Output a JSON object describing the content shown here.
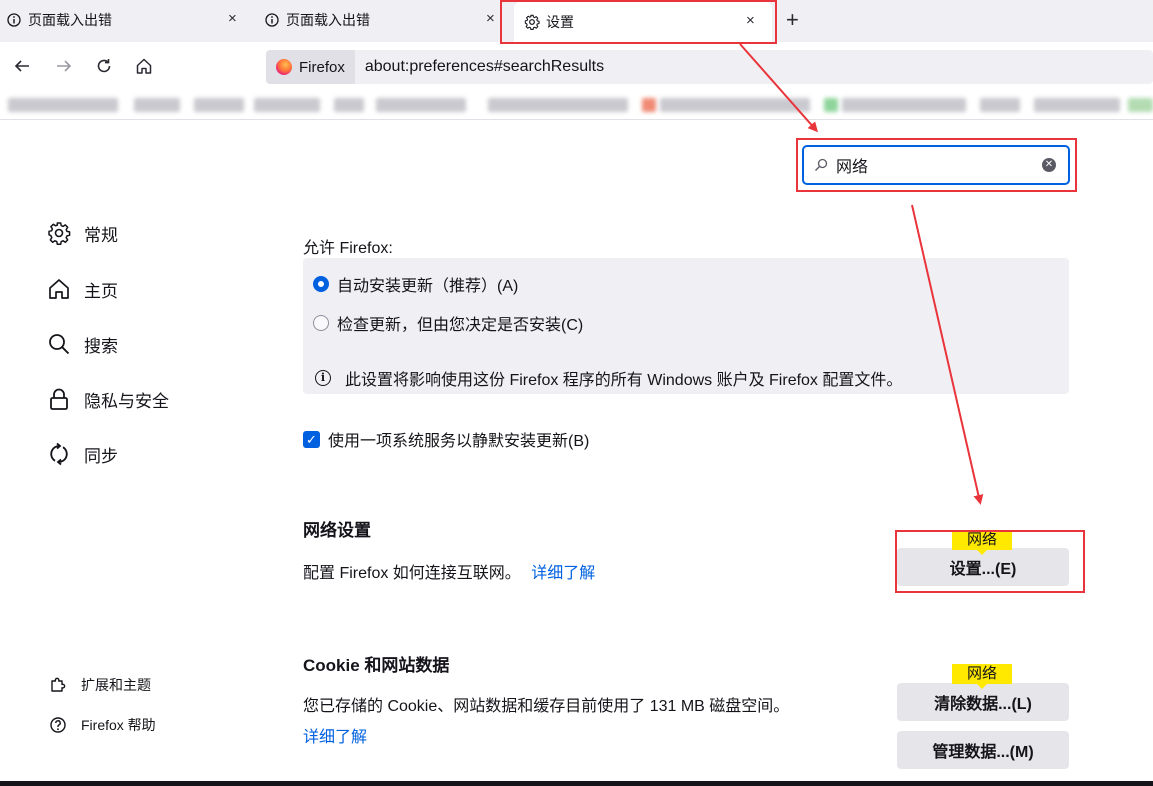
{
  "tabs": [
    {
      "title": "页面载入出错",
      "icon": "info-icon",
      "active": false
    },
    {
      "title": "页面载入出错",
      "icon": "info-icon",
      "active": false
    },
    {
      "title": "设置",
      "icon": "gear-icon",
      "active": true
    }
  ],
  "tab_close_glyph": "×",
  "new_tab_glyph": "+",
  "urlbar": {
    "identity_label": "Firefox",
    "url": "about:preferences#searchResults"
  },
  "search": {
    "value": "网络"
  },
  "sidebar": {
    "items": [
      {
        "label": "常规",
        "icon": "gear-icon"
      },
      {
        "label": "主页",
        "icon": "home-icon"
      },
      {
        "label": "搜索",
        "icon": "search-icon"
      },
      {
        "label": "隐私与安全",
        "icon": "lock-icon"
      },
      {
        "label": "同步",
        "icon": "sync-icon"
      }
    ],
    "footer": [
      {
        "label": "扩展和主题",
        "icon": "puzzle-icon"
      },
      {
        "label": "Firefox 帮助",
        "icon": "help-icon"
      }
    ]
  },
  "updates": {
    "allow_label": "允许 Firefox:",
    "auto_install": "自动安装更新（推荐）(A)",
    "check_only": "检查更新，但由您决定是否安装(C)",
    "info": "此设置将影响使用这份 Firefox 程序的所有 Windows 账户及 Firefox 配置文件。",
    "background_service": "使用一项系统服务以静默安装更新(B)"
  },
  "network": {
    "heading": "网络设置",
    "description": "配置 Firefox 如何连接互联网。",
    "learn_more": "详细了解",
    "settings_button": "设置...(E)",
    "highlight": "网络"
  },
  "cookies": {
    "heading": "Cookie 和网站数据",
    "description": "您已存储的 Cookie、网站数据和缓存目前使用了 131 MB 磁盘空间。",
    "learn_more": "详细了解",
    "clear_button": "清除数据...(L)",
    "manage_button": "管理数据...(M)",
    "highlight": "网络"
  },
  "colors": {
    "accent": "#0061e0",
    "annotation_red": "#e8343a",
    "highlight": "#ffe900",
    "panel": "#f0f0f4"
  }
}
